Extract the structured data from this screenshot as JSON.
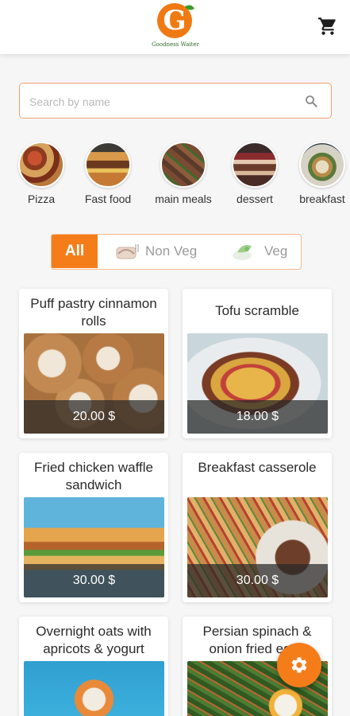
{
  "header": {
    "logo_letter": "G",
    "logo_text": "Goodness Waiter",
    "cart_icon": "cart-icon"
  },
  "search": {
    "placeholder": "Search by name"
  },
  "categories": [
    {
      "label": "Pizza"
    },
    {
      "label": "Fast food"
    },
    {
      "label": "main meals"
    },
    {
      "label": "dessert"
    },
    {
      "label": "breakfast"
    }
  ],
  "filter": {
    "all_label": "All",
    "nonveg_label": "Non Veg",
    "veg_label": "Veg",
    "active": "All"
  },
  "items": [
    {
      "title": "Puff pastry cinnamon rolls",
      "price": "20.00 $"
    },
    {
      "title": "Tofu scramble",
      "price": "18.00 $"
    },
    {
      "title": "Fried chicken waffle sandwich",
      "price": "30.00 $"
    },
    {
      "title": "Breakfast casserole",
      "price": "30.00 $"
    },
    {
      "title": "Overnight oats with apricots & yogurt",
      "price": ""
    },
    {
      "title": "Persian spinach & onion fried eggs",
      "price": ""
    }
  ],
  "colors": {
    "accent": "#f47d1a",
    "background": "#f6f6f6"
  },
  "fab": {
    "icon": "gear-icon"
  }
}
